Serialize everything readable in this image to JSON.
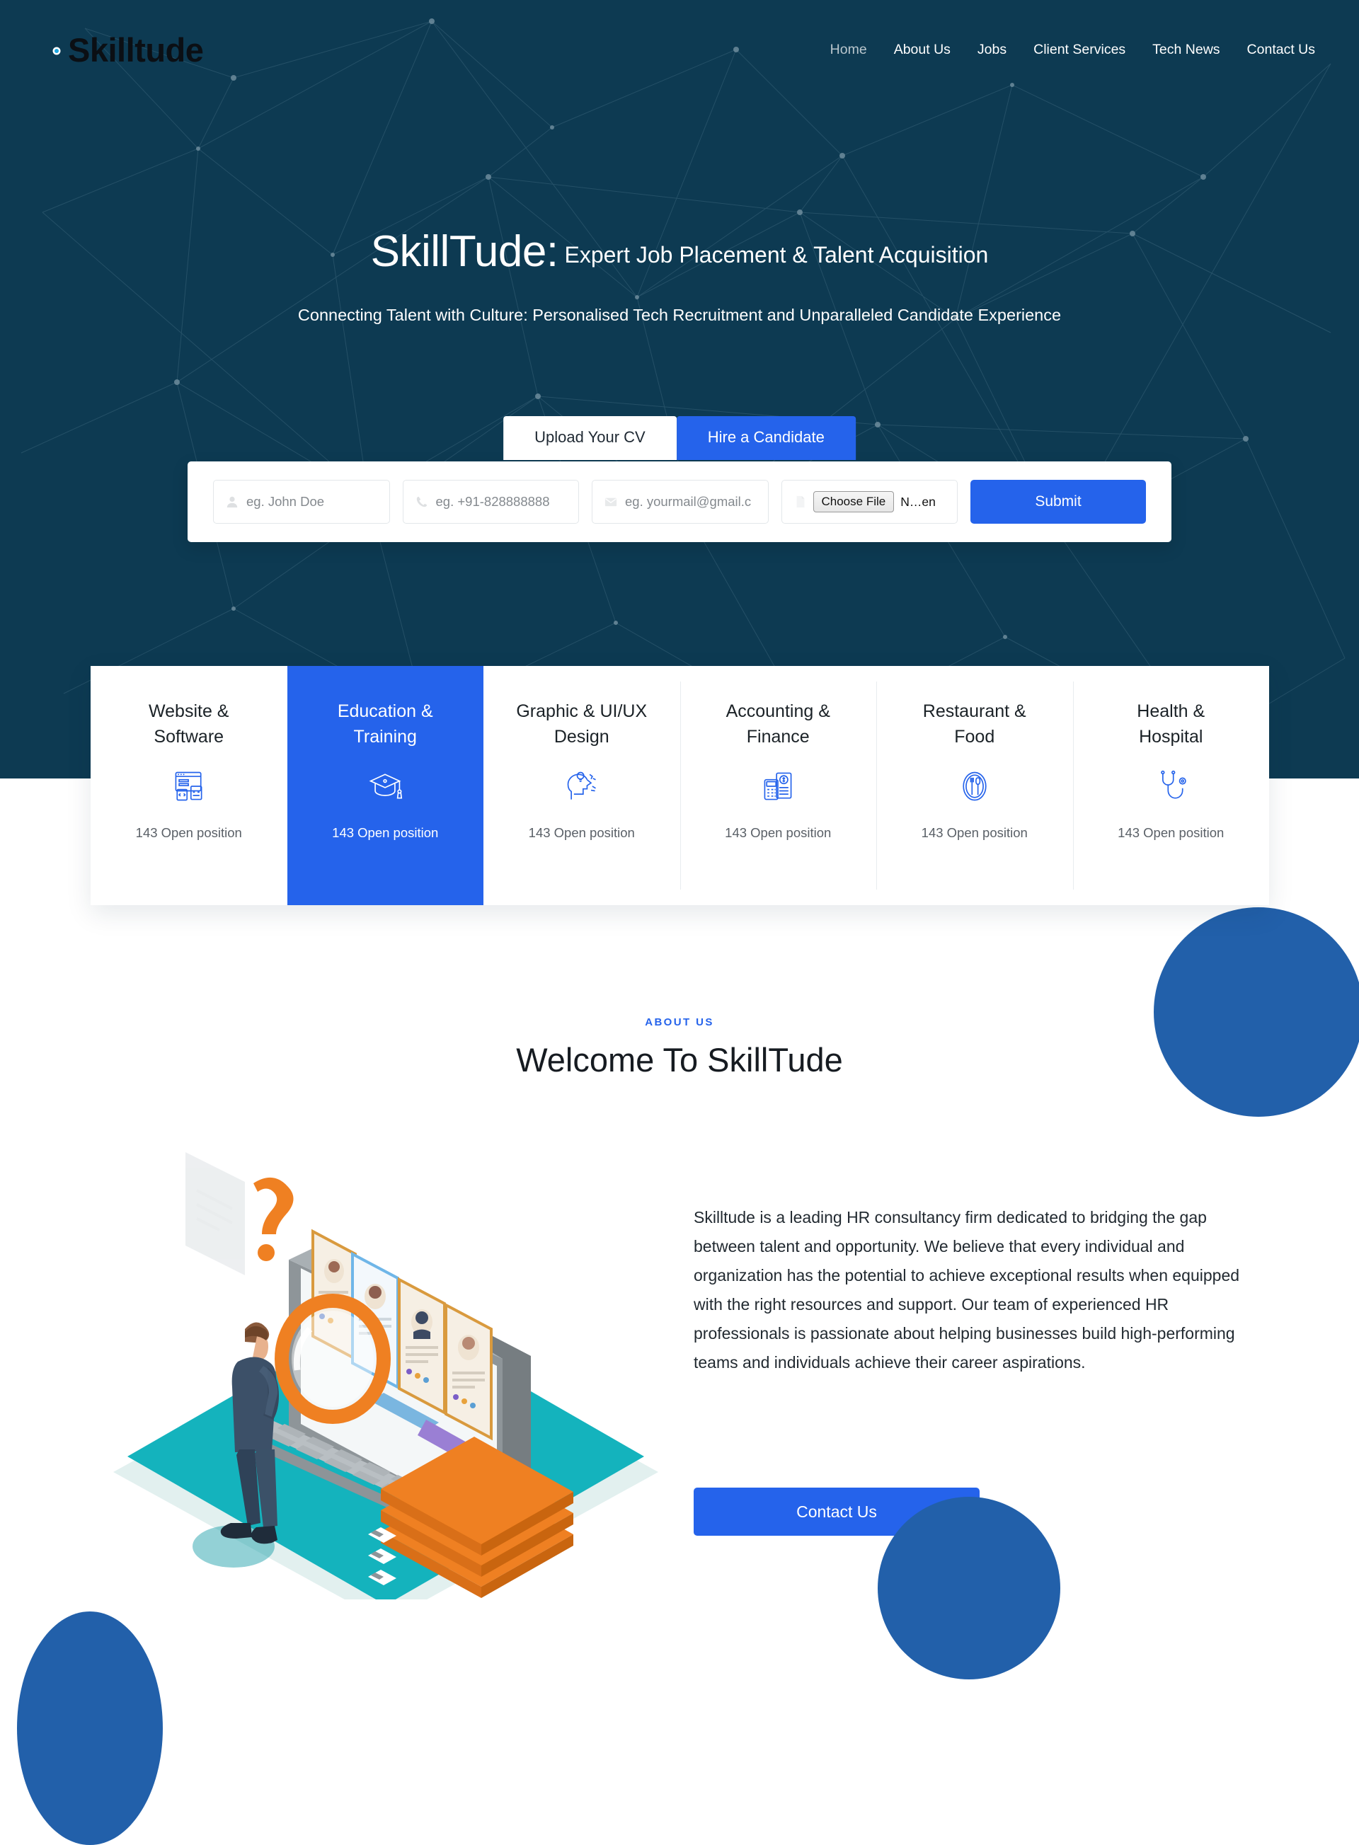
{
  "brand": {
    "name": "Skilltude",
    "mark_icon": "skilltude-swirl-icon"
  },
  "nav": {
    "items": [
      {
        "label": "Home",
        "active": true
      },
      {
        "label": "About Us",
        "active": false
      },
      {
        "label": "Jobs",
        "active": false
      },
      {
        "label": "Client Services",
        "active": false
      },
      {
        "label": "Tech News",
        "active": false
      },
      {
        "label": "Contact Us",
        "active": false
      }
    ]
  },
  "hero": {
    "title_main": "SkillTude:",
    "title_sub": "Expert Job Placement & Talent Acquisition",
    "subtitle": "Connecting Talent with Culture: Personalised Tech Recruitment and Unparalleled Candidate Experience",
    "tabs": [
      {
        "label": "Upload Your CV",
        "state": "active"
      },
      {
        "label": "Hire a Candidate",
        "state": "alt"
      }
    ],
    "form": {
      "name_placeholder": "eg. John Doe",
      "name_value": "",
      "phone_placeholder": "eg. +91-828888888",
      "phone_value": "",
      "email_placeholder": "eg. yourmail@gmail.c",
      "email_value": "",
      "file_button_label": "Choose File",
      "file_name_text": "N…en",
      "submit_label": "Submit"
    }
  },
  "categories": [
    {
      "title": "Website & Software",
      "count": "143 Open position",
      "icon": "browser-code-icon",
      "active": false
    },
    {
      "title": "Education & Training",
      "count": "143 Open position",
      "icon": "graduation-cap-icon",
      "active": true
    },
    {
      "title": "Graphic & UI/UX Design",
      "count": "143 Open position",
      "icon": "creative-head-icon",
      "active": false
    },
    {
      "title": "Accounting & Finance",
      "count": "143 Open position",
      "icon": "pos-terminal-icon",
      "active": false
    },
    {
      "title": "Restaurant & Food",
      "count": "143 Open position",
      "icon": "plate-cutlery-icon",
      "active": false
    },
    {
      "title": "Health & Hospital",
      "count": "143 Open position",
      "icon": "stethoscope-icon",
      "active": false
    }
  ],
  "about": {
    "eyebrow": "ABOUT US",
    "heading": "Welcome To SkillTude",
    "paragraph": "Skilltude is a leading HR consultancy firm dedicated to bridging the gap between talent and opportunity. We believe that every individual and organization has the potential to achieve exceptional results when equipped with the right resources and support. Our team of experienced HR professionals is passionate about helping businesses build high-performing teams and individuals achieve their career aspirations.",
    "cta_label": "Contact Us",
    "illustration": "recruiter-searching-resumes-illustration"
  },
  "colors": {
    "hero_background": "#0d3a52",
    "accent_blue": "#2563eb",
    "decor_blue": "#2260aa",
    "brand_cyan": "#1ea7e1",
    "illus_teal": "#14b3bd",
    "illus_orange": "#ef8022"
  }
}
